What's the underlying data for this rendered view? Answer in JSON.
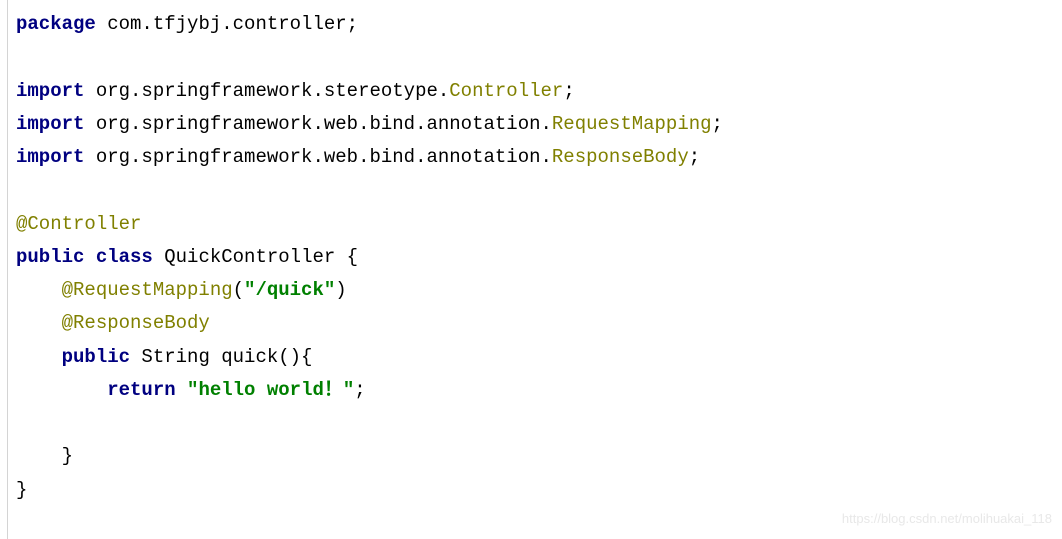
{
  "code": {
    "line1": {
      "kw": "package",
      "text": " com.tfjybj.controller;"
    },
    "line3": {
      "kw": "import",
      "text1": " org.springframework.stereotype.",
      "ann": "Controller",
      "text2": ";"
    },
    "line4": {
      "kw": "import",
      "text1": " org.springframework.web.bind.annotation.",
      "ann": "RequestMapping",
      "text2": ";"
    },
    "line5": {
      "kw": "import",
      "text1": " org.springframework.web.bind.annotation.",
      "ann": "ResponseBody",
      "text2": ";"
    },
    "line7": {
      "ann": "@Controller"
    },
    "line8": {
      "kw1": "public",
      "kw2": "class",
      "text": " QuickController {"
    },
    "line9": {
      "indent": "    ",
      "ann": "@RequestMapping",
      "text1": "(",
      "str": "\"/quick\"",
      "text2": ")"
    },
    "line10": {
      "indent": "    ",
      "ann": "@ResponseBody"
    },
    "line11": {
      "indent": "    ",
      "kw": "public",
      "text": " String quick(){"
    },
    "line12": {
      "indent": "        ",
      "kw": "return",
      "text1": " ",
      "str": "\"hello world！\"",
      "text2": ";"
    },
    "line14": {
      "indent": "    ",
      "text": "}"
    },
    "line15": {
      "text": "}"
    }
  },
  "watermark": "https://blog.csdn.net/molihuakai_118"
}
